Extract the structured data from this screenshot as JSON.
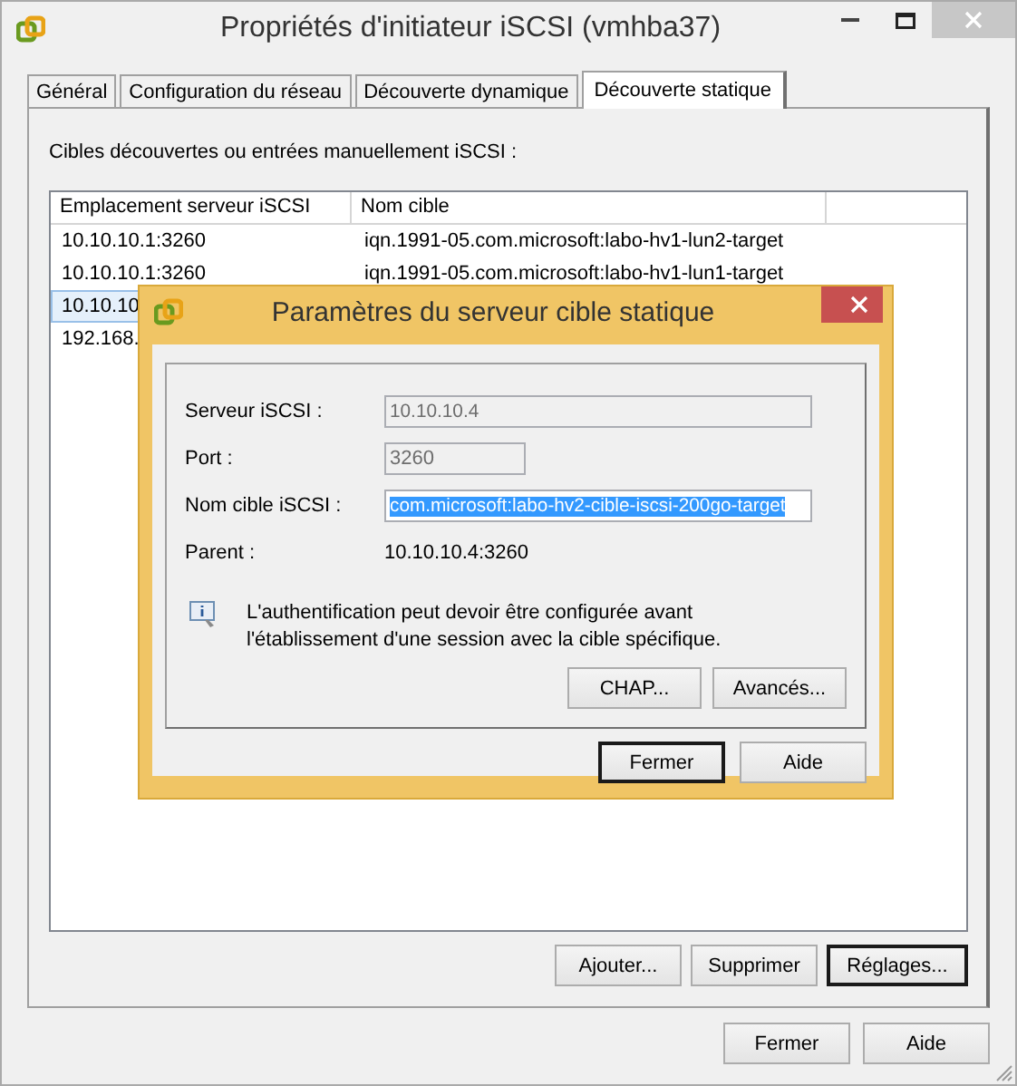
{
  "window": {
    "title": "Propriétés d'initiateur iSCSI (vmhba37)"
  },
  "tabs": [
    {
      "label": "Général",
      "selected": false
    },
    {
      "label": "Configuration du réseau",
      "selected": false
    },
    {
      "label": "Découverte dynamique",
      "selected": false
    },
    {
      "label": "Découverte statique",
      "selected": true
    }
  ],
  "panel": {
    "label": "Cibles découvertes ou entrées manuellement iSCSI :"
  },
  "table": {
    "columns": [
      "Emplacement serveur iSCSI",
      "Nom cible"
    ],
    "rows": [
      {
        "cells": [
          "10.10.10.1:3260",
          "iqn.1991-05.com.microsoft:labo-hv1-lun2-target"
        ],
        "selected": false
      },
      {
        "cells": [
          "10.10.10.1:3260",
          "iqn.1991-05.com.microsoft:labo-hv1-lun1-target"
        ],
        "selected": false
      },
      {
        "cells": [
          "10.10.10"
        ],
        "selected": true
      },
      {
        "cells": [
          "192.168."
        ],
        "selected": false
      }
    ]
  },
  "panel_buttons": [
    {
      "label": "Ajouter...",
      "default": false
    },
    {
      "label": "Supprimer",
      "default": false
    },
    {
      "label": "Réglages...",
      "default": true
    }
  ],
  "buttons": [
    {
      "label": "Fermer",
      "default": false
    },
    {
      "label": "Aide",
      "default": false
    }
  ],
  "dialog": {
    "title": "Paramètres du serveur cible statique",
    "fields": [
      {
        "kind": "input",
        "label": "Serveur iSCSI :",
        "value": "10.10.10.4",
        "disabled": true,
        "selected": false
      },
      {
        "kind": "input",
        "label": "Port :",
        "value": "3260",
        "disabled": true,
        "selected": false
      },
      {
        "kind": "input",
        "label": "Nom cible iSCSI :",
        "value": "com.microsoft:labo-hv2-cible-iscsi-200go-target",
        "disabled": false,
        "selected": true
      },
      {
        "kind": "text",
        "label": "Parent :",
        "value": "10.10.10.4:3260"
      }
    ],
    "info": "L'authentification peut devoir être configurée avant\nl'établissement d'une session avec la cible spécifique.",
    "group_buttons": [
      {
        "label": "CHAP...",
        "default": false
      },
      {
        "label": "Avancés...",
        "default": false
      }
    ],
    "buttons": [
      {
        "label": "Fermer",
        "default": true
      },
      {
        "label": "Aide",
        "default": false
      }
    ]
  }
}
